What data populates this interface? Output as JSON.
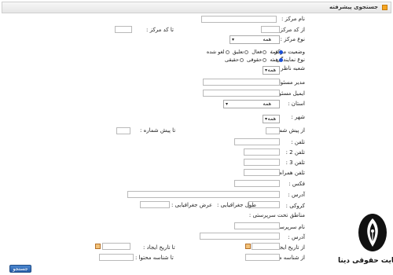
{
  "header": {
    "title": "جستجوی پیشرفته"
  },
  "labels": {
    "center_name": "نام مرکز :",
    "from_center_code": "از کد مرکز :",
    "to_center_code": "تا کد مرکز :",
    "center_type": "نوع مرکز :",
    "center_status": "وضعیت مرکز :",
    "representation_type": "نوع نمایندگی :",
    "supervisor_branch": "شعبه ناظر :",
    "manager": "مدیر مسئول :",
    "manager_email": "ایمیل مسئول :",
    "province": "استان :",
    "city": "شهر :",
    "from_prefix": "از پیش شماره :",
    "to_prefix": "تا پیش شماره :",
    "phone": "تلفن :",
    "phone2": "تلفن 2 :",
    "phone3": "تلفن 3 :",
    "mobile": "تلفن همراه :",
    "fax": "فکس :",
    "address": "آدرس :",
    "geo": "کروکی :",
    "longitude": "طول جغرافیایی :",
    "latitude": "عرض جغرافیایی :",
    "covered_areas": "مناطق تحت سرپرستی :",
    "supervisor_name": "نام سرپرست :",
    "supervisor_address": "آدرس :",
    "from_create_date": "از تاریخ ایجاد :",
    "to_create_date": "تا تاریخ ایجاد :",
    "from_content_id": "از شناسه محتوا :",
    "to_content_id": "تا شناسه محتوا :"
  },
  "selects": {
    "center_type": "همه",
    "supervisor_branch": "همه",
    "province": "همه",
    "city": "همه"
  },
  "status_options": [
    "همه",
    "فعال",
    "تعلیق",
    "لغو شده"
  ],
  "status_selected": "همه",
  "representation_options": [
    "همه",
    "حقوقی",
    "حقیقی"
  ],
  "representation_selected": "همه",
  "search_button": "جستجو",
  "watermark": "سایت حقوقی دینا"
}
